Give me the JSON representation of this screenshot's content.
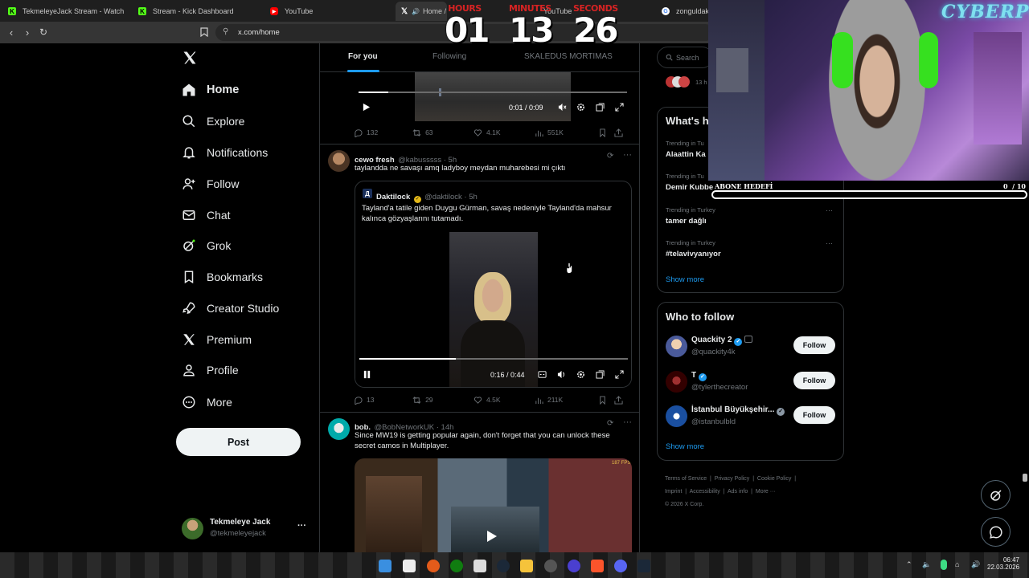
{
  "browser": {
    "tabs": [
      {
        "label": "TekmeleyeJack Stream - Watch Live",
        "icon": "kick-icon",
        "color": "#53fc18"
      },
      {
        "label": "Stream - Kick Dashboard",
        "icon": "kick-icon",
        "color": "#53fc18"
      },
      {
        "label": "YouTube",
        "icon": "youtube-icon",
        "color": "#ff0000"
      },
      {
        "label": "Home / X",
        "icon": "x-icon",
        "color": "#ffffff"
      },
      {
        "label": "YouTube",
        "icon": "youtube-icon",
        "color": "#ff0000"
      },
      {
        "label": "zonguldak k",
        "icon": "google-icon",
        "color": "#4285f4"
      }
    ],
    "url": "x.com/home"
  },
  "timer": {
    "hours_label": "HOURS",
    "hours": "01",
    "minutes_label": "MINUTES",
    "minutes": "13",
    "seconds_label": "SECONDS",
    "seconds": "26"
  },
  "nav": {
    "items": [
      {
        "label": "Home",
        "icon": "home-icon"
      },
      {
        "label": "Explore",
        "icon": "search-icon"
      },
      {
        "label": "Notifications",
        "icon": "bell-icon"
      },
      {
        "label": "Follow",
        "icon": "add-person-icon"
      },
      {
        "label": "Chat",
        "icon": "mail-icon"
      },
      {
        "label": "Grok",
        "icon": "grok-icon"
      },
      {
        "label": "Bookmarks",
        "icon": "bookmark-icon"
      },
      {
        "label": "Creator Studio",
        "icon": "rocket-icon"
      },
      {
        "label": "Premium",
        "icon": "x-icon"
      },
      {
        "label": "Profile",
        "icon": "person-icon"
      },
      {
        "label": "More",
        "icon": "more-circle-icon"
      }
    ],
    "post_label": "Post",
    "account": {
      "name": "Tekmeleye Jack",
      "handle": "@tekmeleyejack",
      "more": "···"
    }
  },
  "feed": {
    "tabs": [
      "For you",
      "Following",
      "SKALEDUS MORTIMAS"
    ],
    "tweet0": {
      "video_time": "0:01 / 0:09",
      "video_progress": 0.11,
      "replies": "132",
      "reposts": "63",
      "likes": "4.1K",
      "views": "551K"
    },
    "tweet1": {
      "name": "cewo fresh",
      "handle": "@kabusssss · 5h",
      "text": "taylandda ne savaşı amq ladyboy meydan muharebesi mi çıktı",
      "quote": {
        "name": "Daktilock",
        "handle": "@daktilock · 5h",
        "text": "Tayland'a tatile giden Duygu Gürman, savaş nedeniyle Tayland'da mahsur kalınca gözyaşlarını tutamadı."
      },
      "video_time": "0:16 / 0:44",
      "video_progress": 0.36,
      "replies": "13",
      "reposts": "29",
      "likes": "4.5K",
      "views": "211K"
    },
    "tweet2": {
      "name": "bob.",
      "handle": "@BobNetworkUK · 14h",
      "text": "Since MW19 is getting popular again, don't forget that you can unlock these secret camos in Multiplayer.",
      "fps_label": "187 FPS"
    }
  },
  "sidebar": {
    "search_placeholder": "Search",
    "avatars_count": "13 h",
    "whats_happening": "What's h",
    "trends": [
      {
        "sub": "Trending in Tu",
        "name": "Alaattin Ka"
      },
      {
        "sub": "Trending in Tu",
        "name": "Demir Kubbe"
      },
      {
        "sub": "Trending in Turkey",
        "name": "tamer dağlı"
      },
      {
        "sub": "Trending in Turkey",
        "name": "#telavivyanıyor"
      }
    ],
    "show_more": "Show more",
    "who_to_follow": "Who to follow",
    "follow_suggestions": [
      {
        "name": "Quackity 2",
        "handle": "@quackity4k",
        "button": "Follow"
      },
      {
        "name": "T",
        "handle": "@tylerthecreator",
        "button": "Follow"
      },
      {
        "name": "İstanbul Büyükşehir...",
        "handle": "@istanbulbld",
        "button": "Follow"
      }
    ],
    "show_more_2": "Show more",
    "footer": {
      "links1": [
        "Terms of Service",
        "Privacy Policy",
        "Cookie Policy"
      ],
      "links2": [
        "Imprint",
        "Accessibility",
        "Ads info",
        "More ···"
      ],
      "copyright": "© 2026 X Corp."
    }
  },
  "overlay": {
    "cyberpunk_sign": "CYBERPUNK",
    "goal_label": "ABONE HEDEFİ",
    "goal_current": "0",
    "goal_target": "/ 10",
    "goal_progress": 0
  },
  "taskbar": {
    "time": "06:47",
    "date": "22.03.2026"
  },
  "colors": {
    "accent_blue": "#1d9bf0",
    "kick_green": "#53fc18",
    "timer_red": "#d62323"
  }
}
